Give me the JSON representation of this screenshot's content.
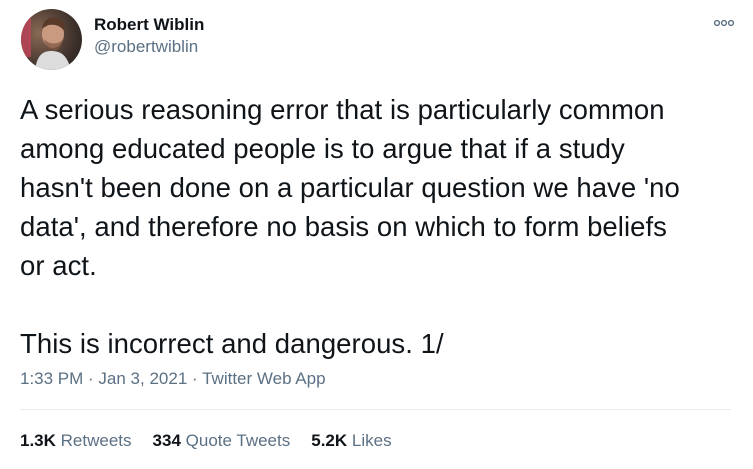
{
  "author": {
    "display_name": "Robert Wiblin",
    "handle": "@robertwiblin"
  },
  "icons": {
    "more": "more-options-icon",
    "avatar": "profile-photo"
  },
  "tweet": {
    "text": "A serious reasoning error that is particularly common\namong educated people is to argue that if a study\nhasn't been done on a particular question we have 'no\ndata', and therefore no basis on which to form beliefs\nor act.\n\nThis is incorrect and dangerous. 1/"
  },
  "meta": {
    "time": "1:33 PM",
    "separator": " · ",
    "date": "Jan 3, 2021",
    "source": "Twitter Web App"
  },
  "stats": {
    "retweets_count": "1.3K",
    "retweets_label": "Retweets",
    "quote_tweets_count": "334",
    "quote_tweets_label": "Quote Tweets",
    "likes_count": "5.2K",
    "likes_label": "Likes"
  },
  "colors": {
    "text_primary": "#0f1419",
    "text_secondary": "#5b7083",
    "divider": "#e6ecf0",
    "background": "#ffffff"
  }
}
